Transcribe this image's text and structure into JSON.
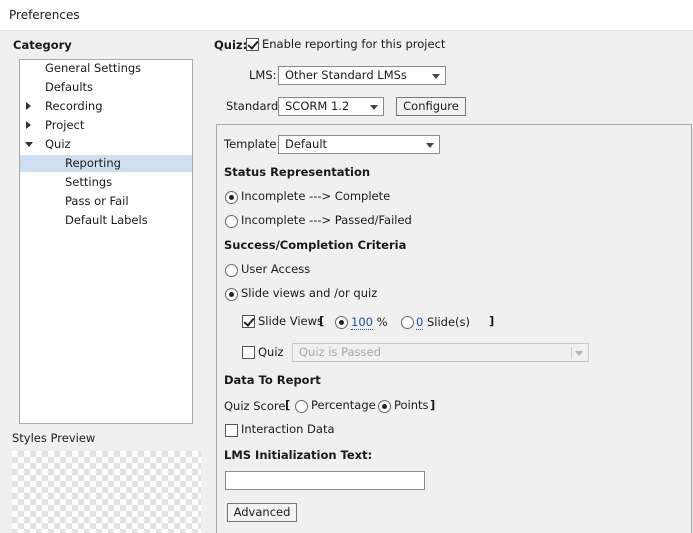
{
  "window": {
    "title": "Preferences"
  },
  "left": {
    "category_label": "Category",
    "tree": [
      {
        "label": "General Settings",
        "level": 0,
        "expander": "",
        "selected": false
      },
      {
        "label": "Defaults",
        "level": 0,
        "expander": "",
        "selected": false
      },
      {
        "label": "Recording",
        "level": 0,
        "expander": "collapsed",
        "selected": false
      },
      {
        "label": "Project",
        "level": 0,
        "expander": "collapsed",
        "selected": false
      },
      {
        "label": "Quiz",
        "level": 0,
        "expander": "expanded",
        "selected": false
      },
      {
        "label": "Reporting",
        "level": 1,
        "expander": "",
        "selected": true
      },
      {
        "label": "Settings",
        "level": 1,
        "expander": "",
        "selected": false
      },
      {
        "label": "Pass or Fail",
        "level": 1,
        "expander": "",
        "selected": false
      },
      {
        "label": "Default Labels",
        "level": 1,
        "expander": "",
        "selected": false
      }
    ],
    "styles_preview_label": "Styles Preview"
  },
  "quiz": {
    "label": "Quiz:",
    "enable_reporting_label": "Enable reporting for this project",
    "enable_reporting_checked": true
  },
  "lms": {
    "label": "LMS:",
    "value": "Other Standard LMSs"
  },
  "standard": {
    "label": "Standard:",
    "value": "SCORM 1.2",
    "configure_label": "Configure"
  },
  "template": {
    "label": "Template:",
    "value": "Default"
  },
  "status": {
    "heading": "Status Representation",
    "option1": "Incomplete ---> Complete",
    "option2": "Incomplete ---> Passed/Failed",
    "selected": "option1"
  },
  "criteria": {
    "heading": "Success/Completion Criteria",
    "user_access": "User Access",
    "slide_views_quiz": "Slide views and /or quiz",
    "selected": "slide_views_quiz",
    "slide_views_label": "Slide Views",
    "slide_views_checked": true,
    "open_bracket": "[",
    "close_bracket": "]",
    "percent_value": "100",
    "percent_sign": "%",
    "slides_value": "0",
    "slides_label": "Slide(s)",
    "quiz_label": "Quiz",
    "quiz_checked": false,
    "quiz_select_value": "Quiz is Passed"
  },
  "report": {
    "heading": "Data To Report",
    "quiz_score_label": "Quiz Score",
    "open_bracket": "[",
    "close_bracket": "]",
    "percentage_label": "Percentage",
    "points_label": "Points",
    "selected": "points",
    "interaction_label": "Interaction Data",
    "interaction_checked": false
  },
  "lms_init": {
    "heading": "LMS Initialization Text:",
    "value": ""
  },
  "advanced": {
    "label": "Advanced"
  }
}
